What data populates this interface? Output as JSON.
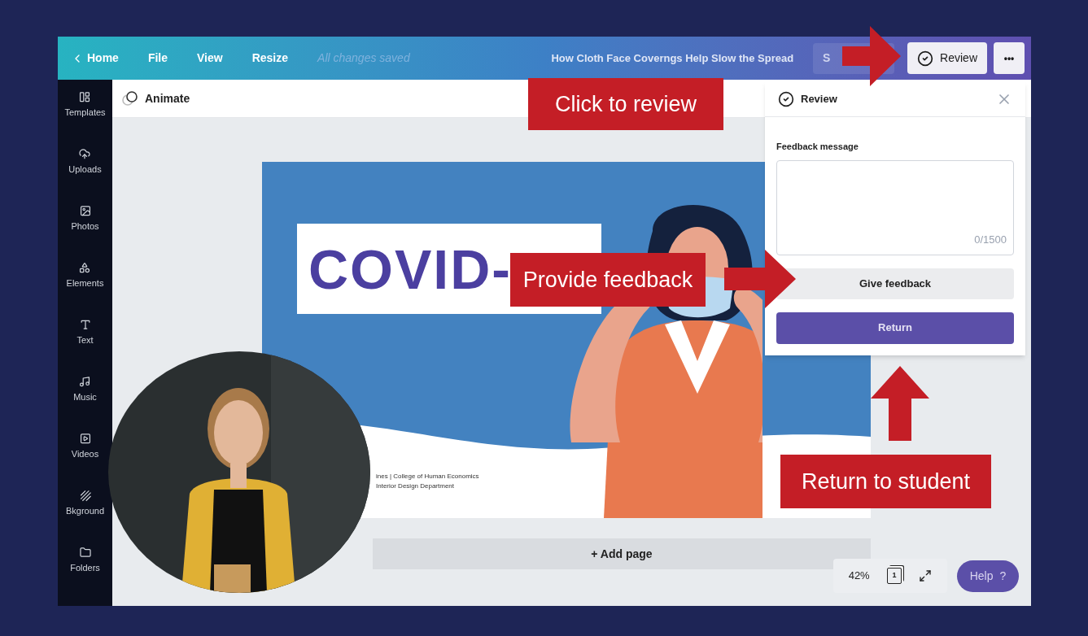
{
  "topbar": {
    "back": "Home",
    "menu": [
      "File",
      "View",
      "Resize"
    ],
    "save_status": "All changes saved",
    "title": "How Cloth Face Coverngs Help Slow the Spread",
    "share_text": "S",
    "review_button": "Review",
    "more": "•••"
  },
  "sidebar": [
    {
      "label": "Templates",
      "kind": "templates"
    },
    {
      "label": "Uploads",
      "kind": "uploads"
    },
    {
      "label": "Photos",
      "kind": "photos"
    },
    {
      "label": "Elements",
      "kind": "elements"
    },
    {
      "label": "Text",
      "kind": "text"
    },
    {
      "label": "Music",
      "kind": "music"
    },
    {
      "label": "Videos",
      "kind": "videos"
    },
    {
      "label": "Bkground",
      "kind": "background"
    },
    {
      "label": "Folders",
      "kind": "folders"
    }
  ],
  "toolbar": {
    "animate": "Animate"
  },
  "slide": {
    "heading": "COVID-",
    "caption_lines": [
      "ines | College of Human Economics",
      "Interior Design Department"
    ]
  },
  "add_page": "+ Add page",
  "footer": {
    "zoom": "42%",
    "page_count": "1",
    "help": "Help",
    "help_mark": "?"
  },
  "review_panel": {
    "title": "Review",
    "label": "Feedback message",
    "counter": "0/1500",
    "give_feedback": "Give feedback",
    "return": "Return"
  },
  "annotations": [
    {
      "text": "Click to review",
      "kind": "top"
    },
    {
      "text": "Provide feedback",
      "kind": "middle"
    },
    {
      "text": "Return to student",
      "kind": "bottom"
    }
  ]
}
